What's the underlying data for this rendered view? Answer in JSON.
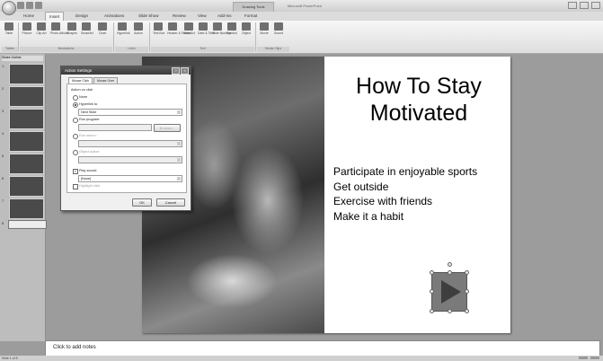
{
  "window": {
    "app_title": "Microsoft PowerPoint",
    "contextual_tab": "Drawing Tools"
  },
  "ribbon": {
    "tabs": [
      "Home",
      "Insert",
      "Design",
      "Animations",
      "Slide Show",
      "Review",
      "View",
      "Add-Ins",
      "Format"
    ],
    "active_tab": "Insert",
    "buttons": [
      "Table",
      "Picture",
      "Clip Art",
      "Photo Album",
      "Shapes",
      "SmartArt",
      "Chart",
      "Hyperlink",
      "Action",
      "Text Box",
      "Header & Footer",
      "WordArt",
      "Date & Time",
      "Slide Number",
      "Symbol",
      "Object",
      "Movie",
      "Sound"
    ],
    "groups": [
      "Tables",
      "Illustrations",
      "Links",
      "Text",
      "Media Clips"
    ]
  },
  "slide_panel": {
    "tabs": [
      "Slides",
      "Outline"
    ],
    "slide_numbers": [
      "1",
      "2",
      "3",
      "4",
      "5",
      "6",
      "7",
      "8"
    ]
  },
  "slide": {
    "title": "How To Stay Motivated",
    "bullets": [
      "Participate in enjoyable sports",
      "Get outside",
      "Exercise with friends",
      "Make it a habit"
    ]
  },
  "dialog": {
    "title": "Action Settings",
    "tabs": [
      "Mouse Click",
      "Mouse Over"
    ],
    "section_label": "Action on click",
    "options": {
      "none": "None",
      "hyperlink": "Hyperlink to:",
      "hyperlink_value": "Next Slide",
      "run_program": "Run program:",
      "browse": "Browse...",
      "run_macro": "Run macro:",
      "object_action": "Object action:",
      "play_sound": "Play sound:",
      "sound_value": "[None]",
      "highlight": "Highlight click"
    },
    "ok": "OK",
    "cancel": "Cancel"
  },
  "notes": {
    "placeholder": "Click to add notes"
  },
  "status": {
    "text": "Slide 1 of 8"
  }
}
